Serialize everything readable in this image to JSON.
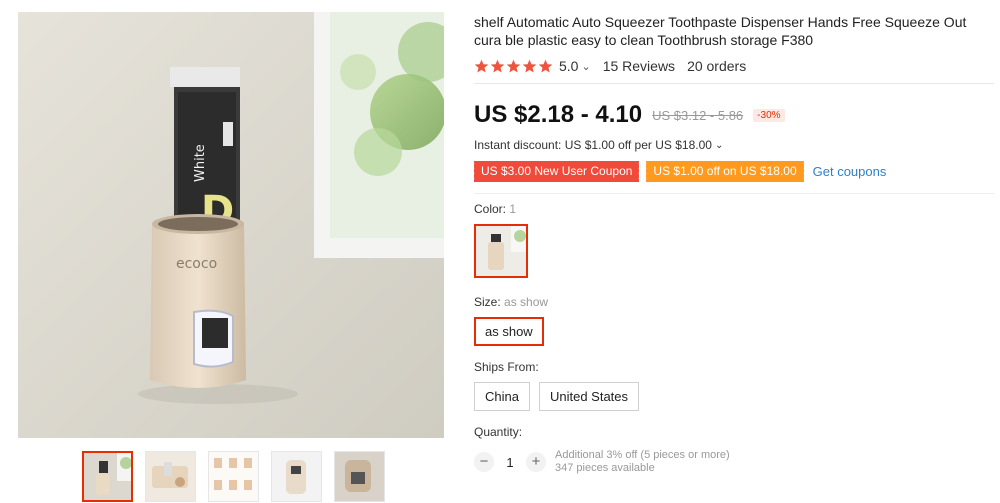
{
  "product": {
    "title": "shelf Automatic Auto Squeezer Toothpaste Dispenser Hands Free Squeeze Out cura ble plastic easy to clean Toothbrush storage F380",
    "rating": "5.0",
    "rating_chevron": "⌄",
    "reviews": "15 Reviews",
    "orders": "20 orders"
  },
  "gallery": {
    "brand_text": "ecoco",
    "tube_brand": "White",
    "tube_letter": "D",
    "thumbnails": [
      {
        "name": "dispenser-front"
      },
      {
        "name": "dispenser-wall"
      },
      {
        "name": "dispenser-steps"
      },
      {
        "name": "dispenser-close"
      },
      {
        "name": "dispenser-side"
      }
    ]
  },
  "price": {
    "current": "US $2.18 - 4.10",
    "original": "US $3.12 - 5.86",
    "discount": "-30%"
  },
  "instant_discount": {
    "text": "Instant discount: US $1.00 off per US $18.00",
    "chevron": "⌄"
  },
  "coupons": {
    "new_user": "US $3.00 New User Coupon",
    "off": "US $1.00 off on US $18.00",
    "get": "Get coupons"
  },
  "color": {
    "label": "Color:",
    "count": "1"
  },
  "size": {
    "label": "Size:",
    "value": "as show",
    "option": "as show"
  },
  "ships": {
    "label": "Ships From:",
    "options": [
      "China",
      "United States"
    ]
  },
  "quantity": {
    "label": "Quantity:",
    "minus": "−",
    "value": "1",
    "plus": "+",
    "note_line1": "Additional 3% off (5 pieces or more)",
    "note_line2": "347 pieces available"
  },
  "colors": {
    "accent": "#e62e04",
    "coupon_red": "#f04a3b",
    "coupon_orange": "#ff9a1f",
    "link": "#2e7fce",
    "star": "#f0523f"
  }
}
